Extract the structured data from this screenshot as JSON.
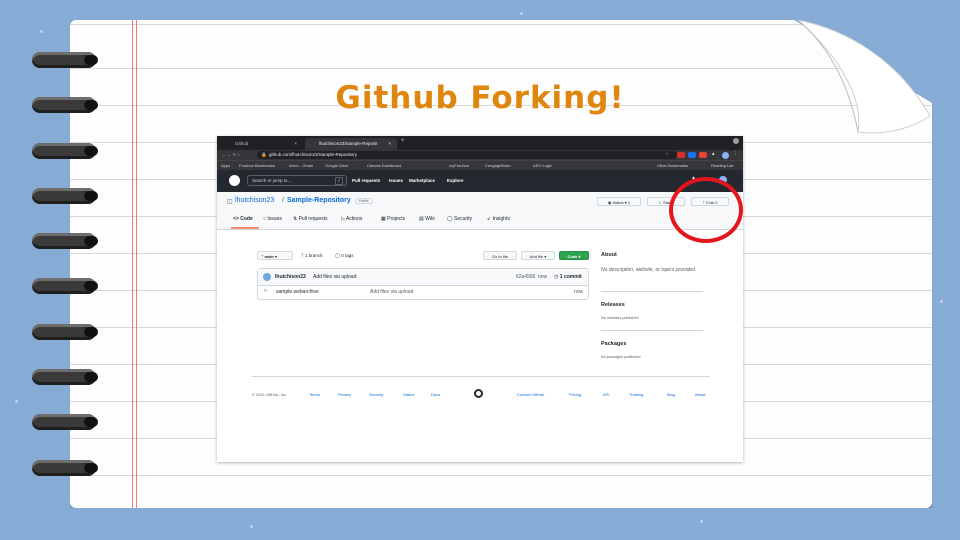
{
  "slide": {
    "title": "Github Forking!"
  },
  "browser": {
    "tabs": [
      {
        "label": "Github",
        "close": "×"
      },
      {
        "label": "lhutchison23/Sample-Reposit",
        "close": "×"
      }
    ],
    "new_tab": "+",
    "url": "github.com/lhutchison23/Sample-Repository",
    "bookmarks": [
      "Apps",
      "Furuhou Bookmarks",
      "Inbox - Gmail",
      "Google Drive",
      "Canvas Dashboard",
      "myFuruhou",
      "CengageBrain",
      "AEO Login"
    ],
    "bookmarks_right": [
      "Other Bookmarks",
      "Reading List"
    ]
  },
  "github": {
    "search_placeholder": "Search or jump to...",
    "search_key": "/",
    "nav": [
      "Pull requests",
      "Issues",
      "Marketplace",
      "Explore"
    ],
    "owner": "lhutchison23",
    "separator": "/",
    "repo": "Sample-Repository",
    "visibility": "Public",
    "watch": {
      "label": "Watch",
      "count": "1"
    },
    "star": {
      "label": "Star",
      "count": "0"
    },
    "fork": {
      "label": "Fork",
      "count": "0"
    },
    "tabs": [
      "Code",
      "Issues",
      "Pull requests",
      "Actions",
      "Projects",
      "Wiki",
      "Security",
      "Insights"
    ],
    "branch_label": "main",
    "branches": "1 branch",
    "tags": "0 tags",
    "go_to_file": "Go to file",
    "add_file": "Add file",
    "code_button": "Code",
    "commit": {
      "author": "lhutchison23",
      "message": "Add files via upload",
      "hash": "62a4586",
      "when": "now",
      "commits": "1 commit"
    },
    "files": [
      {
        "name": "sample.webarchive",
        "message": "Add files via upload",
        "when": "now"
      }
    ],
    "about": {
      "heading": "About",
      "description": "No description, website, or topics provided."
    },
    "releases": {
      "heading": "Releases",
      "text": "No releases published"
    },
    "packages": {
      "heading": "Packages",
      "text": "No packages published"
    },
    "footer_left": [
      "© 2021 GitHub, Inc.",
      "Terms",
      "Privacy",
      "Security",
      "Status",
      "Docs"
    ],
    "footer_right": [
      "Contact GitHub",
      "Pricing",
      "API",
      "Training",
      "Blog",
      "About"
    ]
  },
  "colors": {
    "title": "#e0860e",
    "highlight_circle": "#e3161e",
    "code_button": "#2da44e",
    "link": "#0969da"
  }
}
